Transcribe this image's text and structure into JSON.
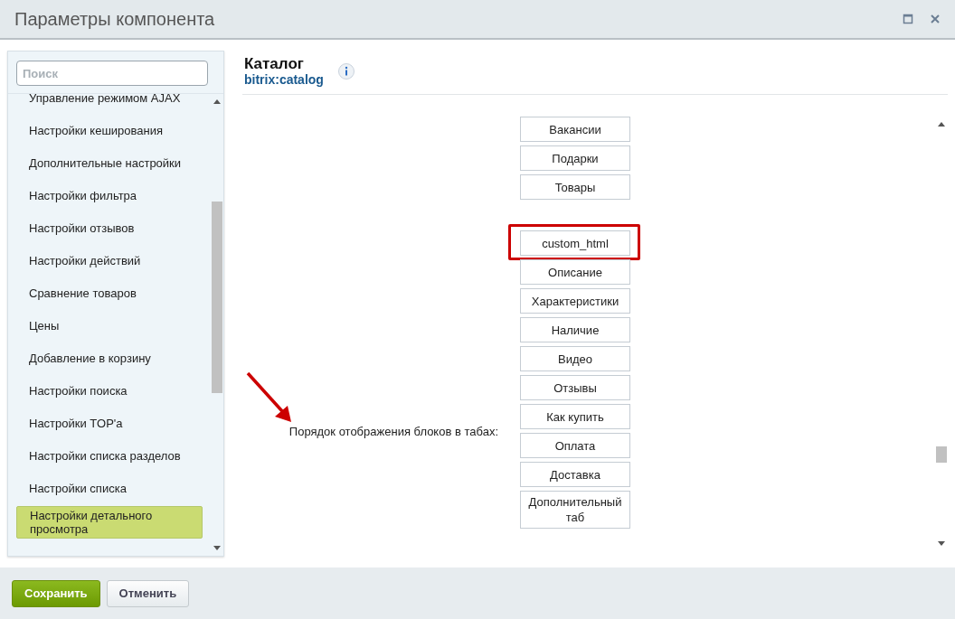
{
  "window": {
    "title": "Параметры компонента"
  },
  "sidebar": {
    "search": {
      "placeholder": "Поиск"
    },
    "items": [
      {
        "label": "Управление режимом AJAX",
        "selected": false
      },
      {
        "label": "Настройки кеширования",
        "selected": false
      },
      {
        "label": "Дополнительные настройки",
        "selected": false
      },
      {
        "label": "Настройки фильтра",
        "selected": false
      },
      {
        "label": "Настройки отзывов",
        "selected": false
      },
      {
        "label": "Настройки действий",
        "selected": false
      },
      {
        "label": "Сравнение товаров",
        "selected": false
      },
      {
        "label": "Цены",
        "selected": false
      },
      {
        "label": "Добавление в корзину",
        "selected": false
      },
      {
        "label": "Настройки поиска",
        "selected": false
      },
      {
        "label": "Настройки TOP'a",
        "selected": false
      },
      {
        "label": "Настройки списка разделов",
        "selected": false
      },
      {
        "label": "Настройки списка",
        "selected": false
      },
      {
        "label": "Настройки детального просмотра",
        "selected": true
      }
    ]
  },
  "component": {
    "name": "Каталог",
    "code": "bitrix:catalog"
  },
  "setting": {
    "label": "Порядок отображения блоков в табах:",
    "groups": [
      [
        {
          "label": "Вакансии",
          "highlighted": false
        },
        {
          "label": "Подарки",
          "highlighted": false
        },
        {
          "label": "Товары",
          "highlighted": false
        }
      ],
      [
        {
          "label": "custom_html",
          "highlighted": true
        },
        {
          "label": "Описание",
          "highlighted": false
        },
        {
          "label": "Характеристики",
          "highlighted": false
        },
        {
          "label": "Наличие",
          "highlighted": false
        },
        {
          "label": "Видео",
          "highlighted": false
        },
        {
          "label": "Отзывы",
          "highlighted": false
        },
        {
          "label": "Как купить",
          "highlighted": false
        },
        {
          "label": "Оплата",
          "highlighted": false
        },
        {
          "label": "Доставка",
          "highlighted": false
        },
        {
          "label": "Дополнительный таб",
          "highlighted": false
        }
      ]
    ]
  },
  "buttons": [
    {
      "label": "Сохранить",
      "kind": "primary"
    },
    {
      "label": "Отменить",
      "kind": "secondary"
    }
  ]
}
